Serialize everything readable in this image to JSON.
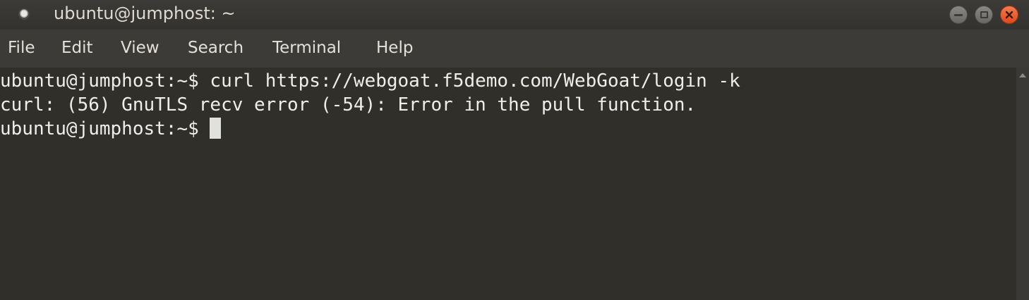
{
  "window": {
    "title": "ubuntu@jumphost: ~"
  },
  "menu": [
    {
      "label": "File"
    },
    {
      "label": "Edit"
    },
    {
      "label": "View"
    },
    {
      "label": "Search"
    },
    {
      "label": "Terminal"
    },
    {
      "label": "Help"
    }
  ],
  "terminal": {
    "lines": [
      {
        "prompt": "ubuntu@jumphost:~$ ",
        "text": "curl https://webgoat.f5demo.com/WebGoat/login -k"
      },
      {
        "prompt": "",
        "text": "curl: (56) GnuTLS recv error (-54): Error in the pull function."
      },
      {
        "prompt": "ubuntu@jumphost:~$ ",
        "text": ""
      }
    ]
  },
  "icons": {
    "window": "terminal-app-icon",
    "minimize": "minimize-icon",
    "maximize": "maximize-icon",
    "close": "close-icon",
    "scroll": "scroll-up-arrow-icon"
  },
  "colors": {
    "terminal_background": "#302f2a",
    "terminal_foreground": "#eeeeec",
    "titlebar": "#3c3b37",
    "close_button": "#e8561e"
  }
}
